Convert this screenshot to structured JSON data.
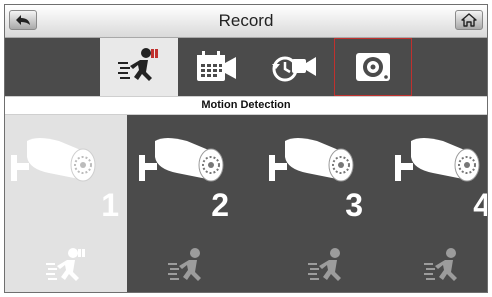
{
  "header": {
    "title": "Record",
    "back_icon": "back-arrow-icon",
    "home_icon": "home-icon"
  },
  "tabs": [
    {
      "icon": "motion-detection-icon",
      "active": true
    },
    {
      "icon": "schedule-record-icon",
      "active": false
    },
    {
      "icon": "record-playback-icon",
      "active": false
    },
    {
      "icon": "storage-disk-icon",
      "active": false,
      "outlined": true
    }
  ],
  "section_label": "Motion Detection",
  "cameras": [
    {
      "number": "1",
      "icon": "security-camera-icon",
      "motion_icon": "motion-running-icon",
      "selected": true
    },
    {
      "number": "2",
      "icon": "security-camera-icon",
      "motion_icon": "motion-running-icon",
      "selected": false
    },
    {
      "number": "3",
      "icon": "security-camera-icon",
      "motion_icon": "motion-running-icon",
      "selected": false
    },
    {
      "number": "4",
      "icon": "security-camera-icon",
      "motion_icon": "motion-running-icon",
      "selected": false
    }
  ],
  "colors": {
    "panel_dark": "#4b4b4b",
    "panel_light": "#e2e2e2",
    "highlight_outline": "#c0312e"
  }
}
